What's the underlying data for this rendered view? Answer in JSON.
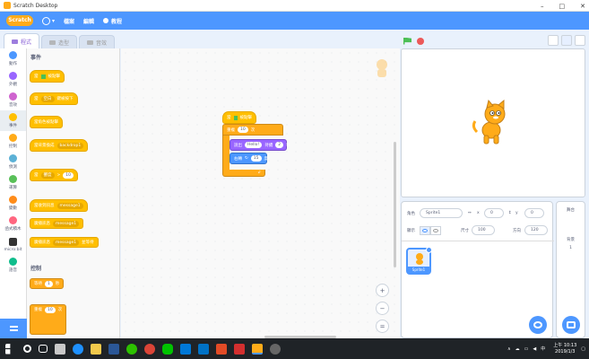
{
  "window": {
    "title": "Scratch Desktop",
    "controls": [
      "–",
      "□",
      "✕"
    ]
  },
  "menubar": {
    "logo": "Scratch",
    "items": [
      "檔案",
      "編輯",
      "教程"
    ]
  },
  "tabs": [
    "程式",
    "造型",
    "音效"
  ],
  "categories": [
    {
      "label": "動作",
      "color": "#4c97ff"
    },
    {
      "label": "外觀",
      "color": "#9966ff"
    },
    {
      "label": "音效",
      "color": "#cf63cf"
    },
    {
      "label": "事件",
      "color": "#ffbf00",
      "selected": true
    },
    {
      "label": "控制",
      "color": "#ffab19"
    },
    {
      "label": "偵測",
      "color": "#5cb1d6"
    },
    {
      "label": "運算",
      "color": "#59c059"
    },
    {
      "label": "變數",
      "color": "#ff8c1a"
    },
    {
      "label": "函式積木",
      "color": "#ff6680"
    },
    {
      "label": "micro:bit",
      "color": "#333333"
    },
    {
      "label": "語音",
      "color": "#0fbd8c"
    }
  ],
  "palette": {
    "heading_events": "事件",
    "heading_control": "控制",
    "events_blocks": [
      {
        "label": "當 被點擊",
        "flag": true
      },
      {
        "label": "當",
        "dropdown": "空白",
        "tail": "鍵被按下"
      },
      {
        "label": "當角色被點擊"
      },
      {
        "label": "當背景換成",
        "dropdown": "backdrop1"
      },
      {
        "label": "當",
        "dropdown": "響度",
        "tail": ">",
        "pill": "10"
      },
      {
        "label": "當收到訊息",
        "dropdown": "message1"
      },
      {
        "label": "廣播訊息",
        "dropdown": "message1"
      },
      {
        "label": "廣播訊息",
        "dropdown": "message1",
        "tail": "並等待"
      }
    ],
    "control_blocks": [
      {
        "label": "等待",
        "pill": "1",
        "tail": "秒"
      },
      {
        "label": "重複",
        "pill": "10",
        "tail": "次"
      }
    ]
  },
  "script": {
    "hat": "當 被點擊",
    "repeat_label": "重複",
    "repeat_count": "10",
    "repeat_tail": "次",
    "say_label": "說出",
    "say_text": "Hello!",
    "say_mid": "持續",
    "say_secs": "2",
    "say_tail": "秒",
    "turn_label": "右轉",
    "turn_deg": "15",
    "turn_tail": "度"
  },
  "zoom": {
    "in": "+",
    "out": "−",
    "reset": "="
  },
  "sprite_info": {
    "sprite_label": "角色",
    "sprite_name": "Sprite1",
    "x_label": "x",
    "x_value": "0",
    "y_label": "y",
    "y_value": "0",
    "show_label": "顯示",
    "size_label": "尺寸",
    "size_value": "100",
    "direction_label": "方向",
    "direction_value": "120"
  },
  "sprite_list": [
    {
      "name": "Sprite1"
    }
  ],
  "stage_pane": {
    "title": "舞台",
    "backdrops_label": "背景",
    "backdrops_count": "1"
  },
  "taskbar": {
    "time": "上午 10:13",
    "date": "2019/1/3",
    "ime": "中"
  },
  "colors": {
    "menubar": "#4d97ff",
    "events": "#ffbf00",
    "control": "#ffab19",
    "looks": "#9966ff",
    "motion": "#4c97ff"
  }
}
